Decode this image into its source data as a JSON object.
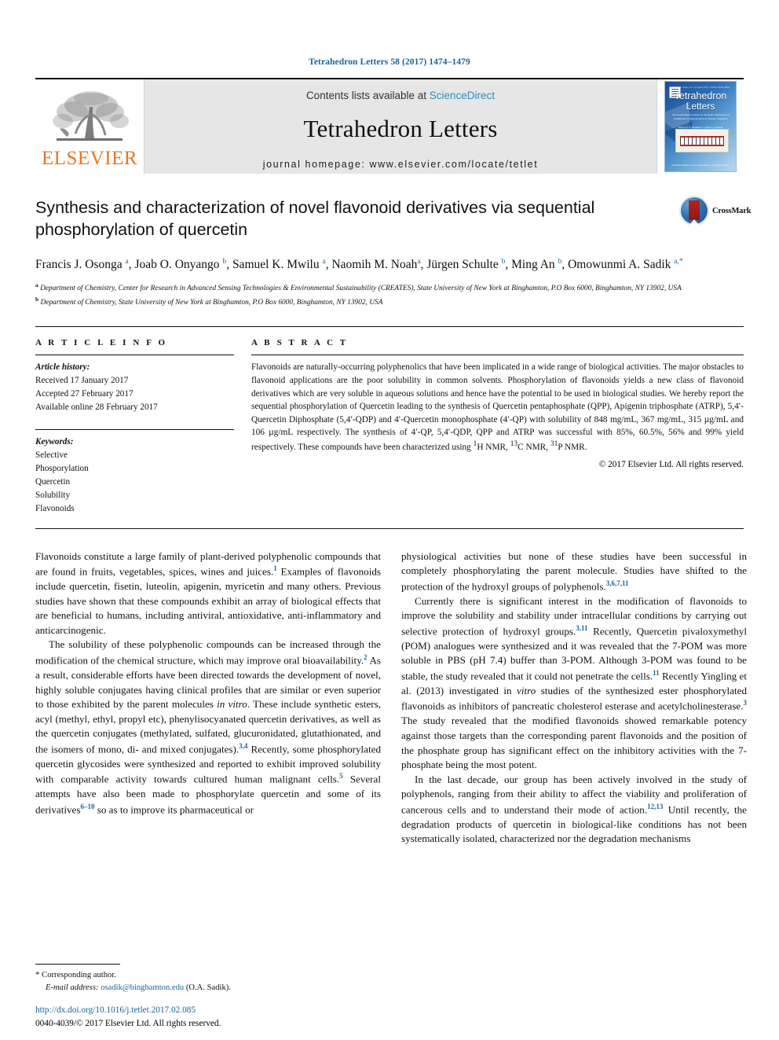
{
  "running_head": "Tetrahedron Letters 58 (2017) 1474–1479",
  "masthead": {
    "publisher_logo_text": "ELSEVIER",
    "contents_prefix": "Contents lists available at ",
    "contents_link": "ScienceDirect",
    "journal_name": "Tetrahedron Letters",
    "homepage": "journal homepage: www.elsevier.com/locate/tetlet",
    "cover": {
      "title_line1": "Tetrahedron",
      "title_line2": "Letters",
      "top_line": "Vol. 58, Issue 15, 12 April 2017  ISSN 0040-4039",
      "subtitle": "The International Journal for the Rapid Publication of Preliminary Communication in Organic Chemistry",
      "editors": "Editors\nS. E. Denmark  J. Aubé  T. Lectka\nK. Nagasawa  B. M. Stoltz",
      "footer": "Available online at www.sciencedirect.com\nScienceDirect"
    }
  },
  "article": {
    "title": "Synthesis and characterization of novel flavonoid derivatives via sequential phosphorylation of quercetin",
    "crossmark_label": "CrossMark",
    "authors_html": "Francis J. Osonga <sup>a</sup>, Joab O. Onyango <sup>b</sup>, Samuel K. Mwilu <sup>a</sup>, Naomih M. Noah<sup>a</sup>, Jürgen Schulte <sup>b</sup>, Ming An <sup>b</sup>, Omowunmi A. Sadik <sup>a,*</sup>",
    "affiliation_a": "Department of Chemistry, Center for Research in Advanced Sensing Technologies & Environmental Sustainability (CREATES), State University of New York at Binghamton, P.O Box 6000, Binghamton, NY 13902, USA",
    "affiliation_b": "Department of Chemistry, State University of New York at Binghamton, P.O Box 6000, Binghamton, NY 13902, USA"
  },
  "article_info": {
    "heading": "A R T I C L E     I N F O",
    "history_label": "Article history:",
    "received": "Received 17 January 2017",
    "accepted": "Accepted 27 February 2017",
    "available": "Available online 28 February 2017",
    "keywords_label": "Keywords:",
    "keywords": [
      "Selective",
      "Phosporylation",
      "Quercetin",
      "Solubility",
      "Flavonoids"
    ]
  },
  "abstract": {
    "heading": "A B S T R A C T",
    "text_html": "Flavonoids are naturally-occurring polyphenolics that have been implicated in a wide range of biological activities. The major obstacles to flavonoid applications are the poor solubility in common solvents. Phosphorylation of flavonoids yields a new class of flavonoid derivatives which are very soluble in aqueous solutions and hence have the potential to be used in biological studies. We hereby report the sequential phosphorylation of Quercetin leading to the synthesis of Quercetin pentaphosphate (QPP), Apigenin triphosphate (ATRP), 5,4&#8242;-Quercetin Diphosphate (5,4&#8242;-QDP) and 4&#8242;-Quercetin monophosphate (4&#8242;-QP) with solubility of 848 mg/mL, 367 mg/mL, 315 &#181;g/mL and 106 &#181;g/mL respectively. The synthesis of 4&#8242;-QP, 5,4&#8242;-QDP, QPP and ATRP was successful with 85%, 60.5%, 56% and 99% yield respectively. These compounds have been characterized using <sup>1</sup>H NMR, <sup>13</sup>C NMR, <sup>31</sup>P NMR.",
    "copyright": "© 2017 Elsevier Ltd. All rights reserved."
  },
  "body": {
    "left_paragraphs_html": [
      "Flavonoids constitute a large family of plant-derived polyphenolic compounds that are found in fruits, vegetables, spices, wines and juices.<sup class=\"ref\">1</sup> Examples of flavonoids include quercetin, fisetin, luteolin, apigenin, myricetin and many others. Previous studies have shown that these compounds exhibit an array of biological effects that are beneficial to humans, including antiviral, antioxidative, anti-inflammatory and anticarcinogenic.",
      "The solubility of these polyphenolic compounds can be increased through the modification of the chemical structure, which may improve oral bioavailability.<sup class=\"ref\">2</sup> As a result, considerable efforts have been directed towards the development of novel, highly soluble conjugates having clinical profiles that are similar or even superior to those exhibited by the parent molecules <i>in vitro</i>. These include synthetic esters, acyl (methyl, ethyl, propyl etc), phenylisocyanated quercetin derivatives, as well as the quercetin conjugates (methylated, sulfated, glucuronidated, glutathionated, and the isomers of mono, di- and mixed conjugates).<sup class=\"ref\">3,4</sup> Recently, some phosphorylated quercetin glycosides were synthesized and reported to exhibit improved solubility with comparable activity towards cultured human malignant cells.<sup class=\"ref\">5</sup> Several attempts have also been made to phosphorylate quercetin and some of its derivatives<sup class=\"ref\">6–10</sup> so as to improve its pharmaceutical or"
    ],
    "right_paragraphs_html": [
      "physiological activities but none of these studies have been successful in completely phosphorylating the parent molecule. Studies have shifted to the protection of the hydroxyl groups of polyphenols.<sup class=\"ref\">3,6,7,11</sup>",
      "Currently there is significant interest in the modification of flavonoids to improve the solubility and stability under intracellular conditions by carrying out selective protection of hydroxyl groups.<sup class=\"ref\">3,11</sup> Recently, Quercetin pivaloxymethyl (POM) analogues were synthesized and it was revealed that the 7-POM was more soluble in PBS (pH 7.4) buffer than 3-POM. Although 3-POM was found to be stable, the study revealed that it could not penetrate the cells.<sup class=\"ref\">11</sup> Recently Yingling et al. (2013) investigated in <i>vitro</i> studies of the synthesized ester phosphorylated flavonoids as inhibitors of pancreatic cholesterol esterase and acetylcholinesterase.<sup class=\"ref\">3</sup> The study revealed that the modified flavonoids showed remarkable potency against those targets than the corresponding parent flavonoids and the position of the phosphate group has significant effect on the inhibitory activities with the 7-phosphate being the most potent.",
      "In the last decade, our group has been actively involved in the study of polyphenols, ranging from their ability to affect the viability and proliferation of cancerous cells and to understand their mode of action.<sup class=\"ref\">12,13</sup> Until recently, the degradation products of quercetin in biological-like conditions has not been systematically isolated, characterized nor the degradation mechanisms"
    ]
  },
  "footer": {
    "corresponding_star": "*",
    "corresponding_label": "Corresponding author.",
    "email_label": "E-mail address:",
    "email": "osadik@binghamton.edu",
    "email_owner": "(O.A. Sadik).",
    "doi": "http://dx.doi.org/10.1016/j.tetlet.2017.02.085",
    "issn_line": "0040-4039/© 2017 Elsevier Ltd. All rights reserved."
  },
  "colors": {
    "link_blue": "#1a6496",
    "elsevier_orange": "#E87722",
    "sciencedirect_blue": "#2b8fc4"
  }
}
